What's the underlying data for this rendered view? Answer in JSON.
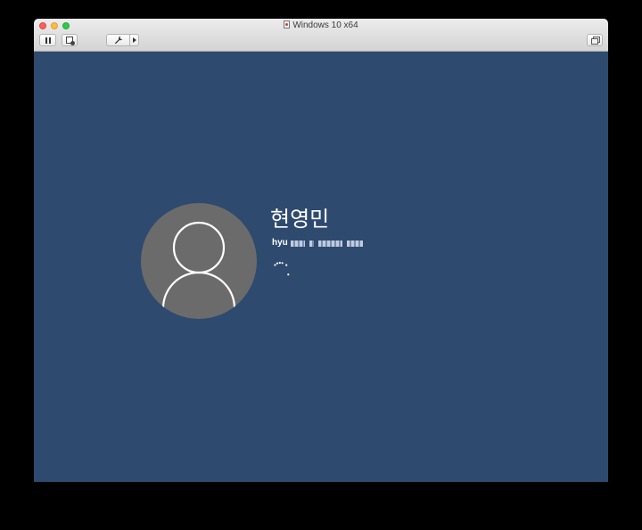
{
  "window": {
    "title": "Windows 10 x64"
  },
  "toolbar": {
    "pause_icon": "pause-icon",
    "snapshot_icon": "snapshot-icon",
    "settings_icon": "wrench-icon",
    "menu_icon": "chevron-right-icon",
    "restore_icon": "window-restore-icon"
  },
  "login": {
    "user_name": "현영민",
    "email_visible": "hyu",
    "avatar_icon": "user-icon",
    "spinner_icon": "loading-spinner-icon"
  },
  "colors": {
    "background": "#2e4a6e",
    "avatar": "#6b6b6b",
    "text": "#ffffff"
  }
}
